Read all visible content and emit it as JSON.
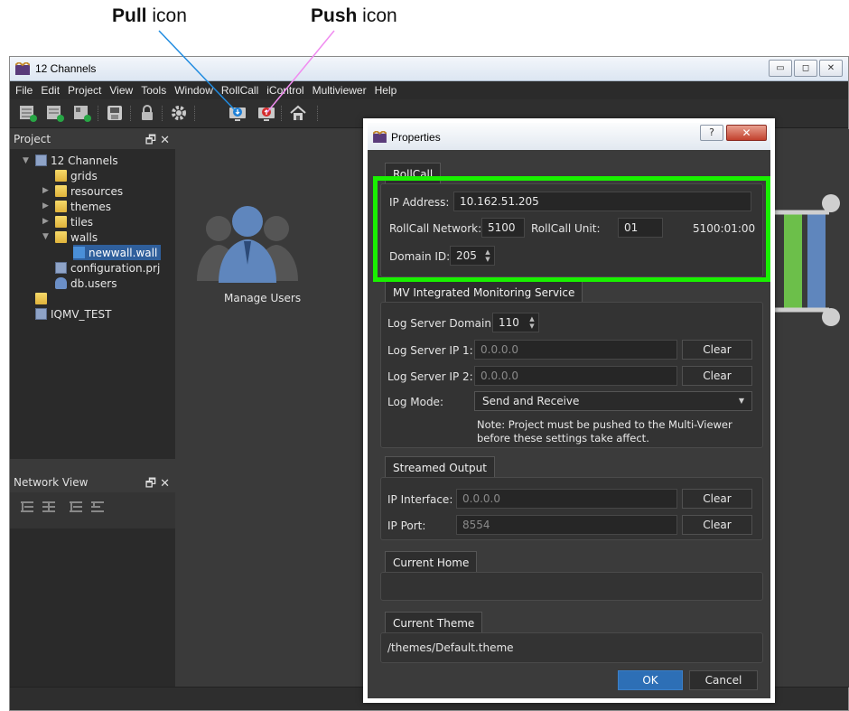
{
  "callouts": {
    "pull_bold": "Pull",
    "pull_rest": " icon",
    "push_bold": "Push",
    "push_rest": " icon"
  },
  "window": {
    "title": "12 Channels",
    "controls": [
      "▭",
      "◻",
      "✕"
    ]
  },
  "menu": [
    "File",
    "Edit",
    "Project",
    "View",
    "Tools",
    "Window",
    "RollCall",
    "iControl",
    "Multiviewer",
    "Help"
  ],
  "toolbar_icons": [
    "new-grid-icon",
    "new-tile-icon",
    "new-wall-icon",
    "save-icon",
    "lock-icon",
    "settings-icon",
    "pull-icon",
    "push-icon",
    "home-icon"
  ],
  "project_dock": {
    "title": "Project",
    "controls": "🗗 ✕",
    "tree": [
      {
        "label": "12 Channels"
      },
      {
        "label": "grids"
      },
      {
        "label": "resources"
      },
      {
        "label": "themes"
      },
      {
        "label": "tiles"
      },
      {
        "label": "walls"
      },
      {
        "label": "newwall.wall"
      },
      {
        "label": "configuration.prj"
      },
      {
        "label": "db.users"
      },
      {
        "label": ""
      },
      {
        "label": "IQMV_TEST"
      }
    ]
  },
  "network_dock": {
    "title": "Network View",
    "controls": "🗗 ✕"
  },
  "center": {
    "manage_users": "Manage Users"
  },
  "dialog": {
    "title": "Properties",
    "help": "?",
    "close": "✕",
    "rollcall": {
      "tab": "RollCall",
      "ip_label": "IP Address:",
      "ip_value": "10.162.51.205",
      "network_label": "RollCall Network:",
      "network_value": "5100",
      "unit_label": "RollCall Unit:",
      "unit_value": "01",
      "address": "5100:01:00",
      "domain_label": "Domain ID:",
      "domain_value": "205"
    },
    "mv": {
      "tab": "MV Integrated Monitoring Service",
      "log_domain_label": "Log Server Domain:",
      "log_domain_value": "110",
      "ip1_label": "Log Server IP 1:",
      "ip1_value": "0.0.0.0",
      "ip2_label": "Log Server IP 2:",
      "ip2_value": "0.0.0.0",
      "clear": "Clear",
      "mode_label": "Log Mode:",
      "mode_value": "Send and Receive",
      "note_line1": "Note: Project must be pushed to the Multi-Viewer",
      "note_line2": "before these settings take affect."
    },
    "stream": {
      "tab": "Streamed Output",
      "iface_label": "IP Interface:",
      "iface_value": "0.0.0.0",
      "port_label": "IP Port:",
      "port_value": "8554",
      "clear": "Clear"
    },
    "home": {
      "tab": "Current Home",
      "value": ""
    },
    "theme": {
      "tab": "Current Theme",
      "value": "/themes/Default.theme"
    },
    "ok": "OK",
    "cancel": "Cancel"
  },
  "colors": {
    "highlight": "#19f000",
    "pull_line": "#1f8be0",
    "push_line": "#f08cf0",
    "primary_button": "#2d6fb6"
  }
}
